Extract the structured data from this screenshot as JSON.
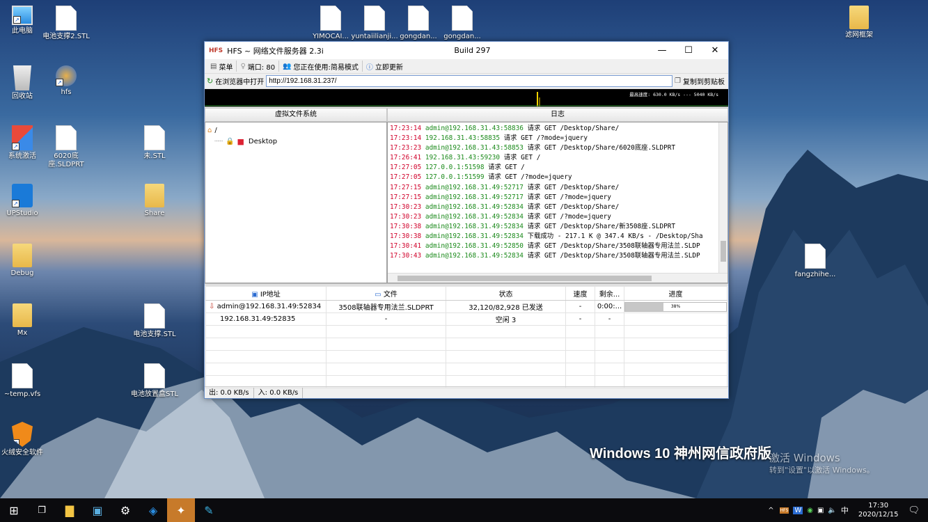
{
  "desktop": {
    "icons": [
      {
        "label": "此电脑",
        "icon": "computer-icon"
      },
      {
        "label": "电池支撑2.STL",
        "icon": "file-icon"
      },
      {
        "label": "回收站",
        "icon": "recycle-bin-icon"
      },
      {
        "label": "hfs",
        "icon": "hfs-app-icon"
      },
      {
        "label": "系统激活",
        "icon": "activation-icon"
      },
      {
        "label": "6020底座.SLDPRT",
        "icon": "file-icon"
      },
      {
        "label": "未.STL",
        "icon": "file-icon"
      },
      {
        "label": "UPStudio",
        "icon": "upstudio-icon"
      },
      {
        "label": "Share",
        "icon": "folder-icon"
      },
      {
        "label": "Debug",
        "icon": "folder-icon"
      },
      {
        "label": "Mx",
        "icon": "folder-icon"
      },
      {
        "label": "电池支撑.STL",
        "icon": "file-icon"
      },
      {
        "label": "~temp.vfs",
        "icon": "file-icon"
      },
      {
        "label": "电池放置盒STL",
        "icon": "file-icon"
      },
      {
        "label": "火绒安全软件",
        "icon": "huorong-icon"
      },
      {
        "label": "YIMOCAI...",
        "icon": "file-icon"
      },
      {
        "label": "yuntaiilianji...",
        "icon": "file-icon"
      },
      {
        "label": "gongdan...",
        "icon": "file-icon"
      },
      {
        "label": "gongdan...",
        "icon": "file-icon"
      },
      {
        "label": "滤网框架",
        "icon": "folder-icon"
      },
      {
        "label": "fangzhihe...",
        "icon": "file-icon"
      }
    ],
    "watermark_title": "Windows 10 神州网信政府版",
    "activate_line1": "激活 Windows",
    "activate_line2": "转到\"设置\"以激活 Windows。"
  },
  "window": {
    "title": "HFS ~ 网络文件服务器 2.3i",
    "build": "Build 297",
    "toolbar": {
      "menu": "菜单",
      "port": "端口: 80",
      "mode": "您正在使用:简易模式",
      "update": "立即更新"
    },
    "open_browser": "在浏览器中打开",
    "url": "http://192.168.31.237/",
    "copy_clipboard": "复制到剪贴板",
    "speed_text": "最高速度: 630.0 KB/s --- 5040 KB/s",
    "vfs_header": "虚拟文件系统",
    "log_header": "日志",
    "tree_root": "/",
    "tree_child": "Desktop",
    "log": [
      {
        "time": "17:23:14",
        "addr": "admin@192.168.31.43:58836",
        "msg": "请求 GET /Desktop/Share/"
      },
      {
        "time": "17:23:14",
        "addr": "192.168.31.43:58835",
        "msg": "请求 GET /?mode=jquery"
      },
      {
        "time": "17:23:23",
        "addr": "admin@192.168.31.43:58853",
        "msg": "请求 GET /Desktop/Share/6020底座.SLDPRT"
      },
      {
        "time": "17:26:41",
        "addr": "192.168.31.43:59230",
        "msg": "请求 GET /"
      },
      {
        "time": "17:27:05",
        "addr": "127.0.0.1:51598",
        "msg": "请求 GET /"
      },
      {
        "time": "17:27:05",
        "addr": "127.0.0.1:51599",
        "msg": "请求 GET /?mode=jquery"
      },
      {
        "time": "17:27:15",
        "addr": "admin@192.168.31.49:52717",
        "msg": "请求 GET /Desktop/Share/"
      },
      {
        "time": "17:27:15",
        "addr": "admin@192.168.31.49:52717",
        "msg": "请求 GET /?mode=jquery"
      },
      {
        "time": "17:30:23",
        "addr": "admin@192.168.31.49:52834",
        "msg": "请求 GET /Desktop/Share/"
      },
      {
        "time": "17:30:23",
        "addr": "admin@192.168.31.49:52834",
        "msg": "请求 GET /?mode=jquery"
      },
      {
        "time": "17:30:38",
        "addr": "admin@192.168.31.49:52834",
        "msg": "请求 GET /Desktop/Share/新3508座.SLDPRT"
      },
      {
        "time": "17:30:38",
        "addr": "admin@192.168.31.49:52834",
        "msg": "下载成功 - 217.1 K @ 347.4 KB/s - /Desktop/Sha"
      },
      {
        "time": "17:30:41",
        "addr": "admin@192.168.31.49:52850",
        "msg": "请求 GET /Desktop/Share/3508联轴器专用法兰.SLDP"
      },
      {
        "time": "17:30:43",
        "addr": "admin@192.168.31.49:52834",
        "msg": "请求 GET /Desktop/Share/3508联轴器专用法兰.SLDP"
      }
    ],
    "conn_headers": {
      "ip": "IP地址",
      "file": "文件",
      "status": "状态",
      "speed": "速度",
      "remain": "剩余...",
      "progress": "进度"
    },
    "connections": [
      {
        "ip": "admin@192.168.31.49:52834",
        "file": "3508联轴器专用法兰.SLDPRT",
        "status": "32,120/82,928 已发送",
        "speed": "-",
        "remain": "0:00:...",
        "progress_text": "38%",
        "progress": 0.38
      },
      {
        "ip": "192.168.31.49:52835",
        "file": "-",
        "status": "空闲 3",
        "speed": "-",
        "remain": "-",
        "progress_text": "",
        "progress": 0
      }
    ],
    "status_out": "出: 0.0 KB/s",
    "status_in": "入: 0.0 KB/s"
  },
  "taskbar": {
    "time": "17:30",
    "date": "2020/12/15",
    "ime": "中",
    "tray_label": "HFS"
  }
}
